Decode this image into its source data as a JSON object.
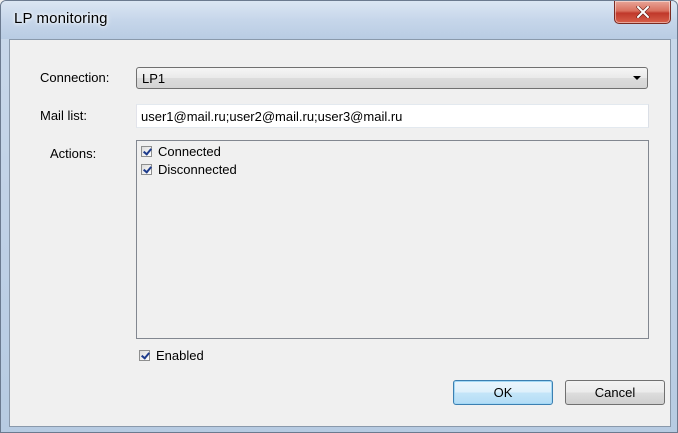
{
  "window": {
    "title": "LP monitoring"
  },
  "icons": {
    "close": "close-icon",
    "dropdown": "chevron-down-icon",
    "check": "checkmark-icon"
  },
  "colors": {
    "close_button": "#c0392b",
    "default_button_border": "#3c7fb1",
    "checkmark": "#1d3b8c"
  },
  "form": {
    "connection_label": "Connection:",
    "connection_value": "LP1",
    "mail_list_label": "Mail list:",
    "mail_list_value": "user1@mail.ru;user2@mail.ru;user3@mail.ru",
    "actions_label": "Actions:",
    "actions": [
      {
        "label": "Connected",
        "checked": true
      },
      {
        "label": "Disconnected",
        "checked": true
      }
    ],
    "enabled_label": "Enabled",
    "enabled_checked": true
  },
  "buttons": {
    "ok": "OK",
    "cancel": "Cancel"
  }
}
